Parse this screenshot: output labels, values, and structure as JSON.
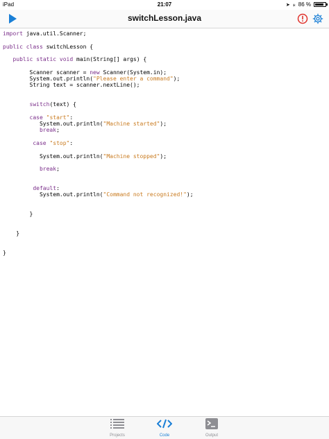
{
  "status": {
    "device": "iPad",
    "time": "21:07",
    "battery": "86 %",
    "battery_level": 0.86
  },
  "header": {
    "title": "switchLesson.java"
  },
  "icons": {
    "run": "play-icon",
    "warning": "warning-icon",
    "settings": "gear-icon"
  },
  "colors": {
    "accent": "#1a7fd6",
    "keyword": "#7a2e8a",
    "string": "#c97a1e",
    "warning": "#e0322c"
  },
  "code": {
    "lines": [
      [
        {
          "t": "import",
          "k": "kw"
        },
        {
          "t": " java.util.Scanner;"
        }
      ],
      [],
      [
        {
          "t": "public",
          "k": "kw"
        },
        {
          "t": " "
        },
        {
          "t": "class",
          "k": "kw"
        },
        {
          "t": " switchLesson {"
        }
      ],
      [],
      [
        {
          "t": "   "
        },
        {
          "t": "public",
          "k": "kw"
        },
        {
          "t": " "
        },
        {
          "t": "static",
          "k": "kw"
        },
        {
          "t": " "
        },
        {
          "t": "void",
          "k": "kw"
        },
        {
          "t": " main(String[] args) {"
        }
      ],
      [],
      [
        {
          "t": "        Scanner scanner = "
        },
        {
          "t": "new",
          "k": "kw"
        },
        {
          "t": " Scanner(System.in);"
        }
      ],
      [
        {
          "t": "        System.out.println("
        },
        {
          "t": "\"Please enter a command\"",
          "k": "str"
        },
        {
          "t": ");"
        }
      ],
      [
        {
          "t": "        String text = scanner.nextLine();"
        }
      ],
      [],
      [],
      [
        {
          "t": "        "
        },
        {
          "t": "switch",
          "k": "kw"
        },
        {
          "t": "(text) {"
        }
      ],
      [],
      [
        {
          "t": "        "
        },
        {
          "t": "case",
          "k": "kw"
        },
        {
          "t": " "
        },
        {
          "t": "\"start\"",
          "k": "str"
        },
        {
          "t": ":"
        }
      ],
      [
        {
          "t": "           System.out.println("
        },
        {
          "t": "\"Machine started\"",
          "k": "str"
        },
        {
          "t": ");"
        }
      ],
      [
        {
          "t": "           "
        },
        {
          "t": "break",
          "k": "kw"
        },
        {
          "t": ";"
        }
      ],
      [],
      [
        {
          "t": "         "
        },
        {
          "t": "case",
          "k": "kw"
        },
        {
          "t": " "
        },
        {
          "t": "\"stop\"",
          "k": "str"
        },
        {
          "t": ":"
        }
      ],
      [],
      [
        {
          "t": "           System.out.println("
        },
        {
          "t": "\"Machine stopped\"",
          "k": "str"
        },
        {
          "t": ");"
        }
      ],
      [],
      [
        {
          "t": "           "
        },
        {
          "t": "break",
          "k": "kw"
        },
        {
          "t": ";"
        }
      ],
      [],
      [],
      [
        {
          "t": "         "
        },
        {
          "t": "default",
          "k": "kw"
        },
        {
          "t": ":"
        }
      ],
      [
        {
          "t": "           System.out.println("
        },
        {
          "t": "\"Command not recognized!\"",
          "k": "str"
        },
        {
          "t": ");"
        }
      ],
      [],
      [],
      [
        {
          "t": "        }"
        }
      ],
      [],
      [],
      [
        {
          "t": "    }"
        }
      ],
      [],
      [],
      [
        {
          "t": "}"
        }
      ]
    ]
  },
  "tabs": [
    {
      "label": "Projects",
      "icon": "list-icon",
      "active": false
    },
    {
      "label": "Code",
      "icon": "code-icon",
      "active": true
    },
    {
      "label": "Output",
      "icon": "terminal-icon",
      "active": false
    }
  ]
}
